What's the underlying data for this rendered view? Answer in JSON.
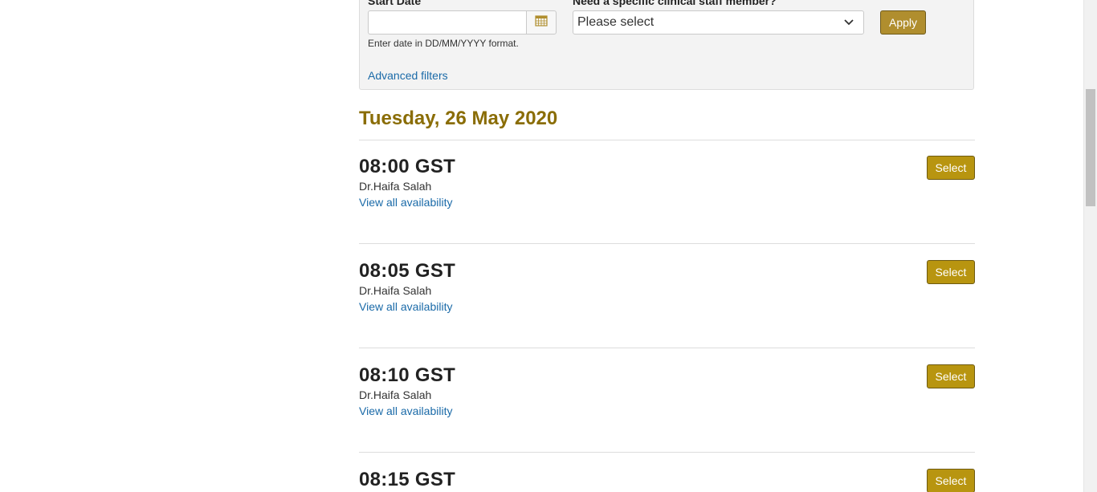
{
  "filters": {
    "start_date_label": "Start Date",
    "start_date_value": "",
    "start_date_hint": "Enter date in DD/MM/YYYY format.",
    "calendar_icon": "calendar-icon",
    "clinician_label": "Need a specific clinical staff member?",
    "clinician_selected": "Please select",
    "apply_label": "Apply",
    "advanced_filters_label": "Advanced filters"
  },
  "day": {
    "heading": "Tuesday, 26 May 2020",
    "slots": [
      {
        "time": "08:00 GST",
        "doctor": "Dr.Haifa Salah",
        "availability_link": "View all availability",
        "select_label": "Select"
      },
      {
        "time": "08:05 GST",
        "doctor": "Dr.Haifa Salah",
        "availability_link": "View all availability",
        "select_label": "Select"
      },
      {
        "time": "08:10 GST",
        "doctor": "Dr.Haifa Salah",
        "availability_link": "View all availability",
        "select_label": "Select"
      },
      {
        "time": "08:15 GST",
        "doctor": "",
        "availability_link": "",
        "select_label": "Select"
      }
    ]
  },
  "colors": {
    "accent_gold": "#b89510",
    "heading_gold": "#8a6d06",
    "link_blue": "#1a6aa8"
  }
}
